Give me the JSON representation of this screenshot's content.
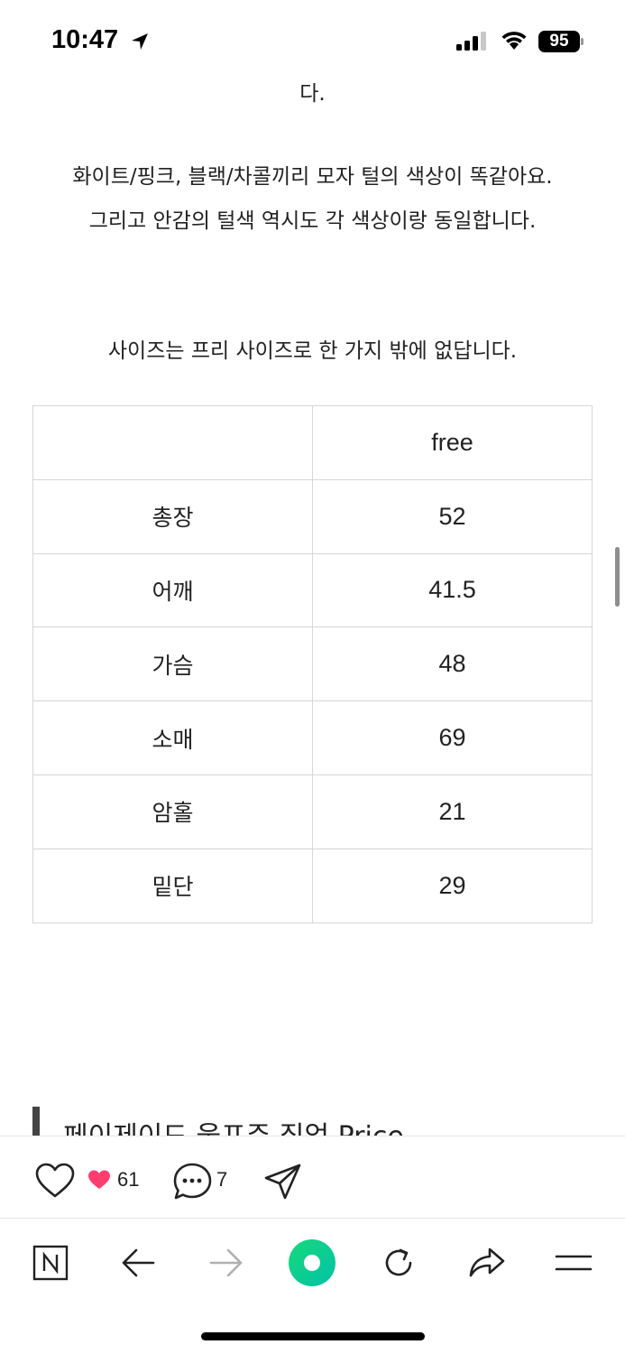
{
  "status_bar": {
    "time": "10:47",
    "battery": "95",
    "icons": [
      "location-arrow-icon",
      "signal-icon",
      "wifi-icon",
      "battery-icon"
    ]
  },
  "article": {
    "text_cut": "다.",
    "text_1": "화이트/핑크, 블랙/차콜끼리 모자 털의 색상이 똑같아요.",
    "text_2": "그리고 안감의 털색 역시도 각 색상이랑 동일합니다.",
    "text_3": "사이즈는 프리 사이즈로 한 가지 밖에 없답니다.",
    "size_table": {
      "header": [
        "",
        "free"
      ],
      "rows": [
        {
          "label": "총장",
          "value": "52"
        },
        {
          "label": "어깨",
          "value": "41.5"
        },
        {
          "label": "가슴",
          "value": "48"
        },
        {
          "label": "소매",
          "value": "69"
        },
        {
          "label": "암홀",
          "value": "21"
        },
        {
          "label": "밑단",
          "value": "29"
        }
      ]
    },
    "section_heading": "페이제이드 울프주 집업 Price"
  },
  "reactions": {
    "like_count": "61",
    "comment_count": "7",
    "accent_color": "#ff3d6e"
  },
  "browser_toolbar": {
    "icons": [
      "naver-n-icon",
      "back-arrow-icon",
      "forward-arrow-icon",
      "green-dot-icon",
      "reload-icon",
      "share-icon",
      "menu-icon"
    ],
    "accent_color": "#03c75a"
  }
}
